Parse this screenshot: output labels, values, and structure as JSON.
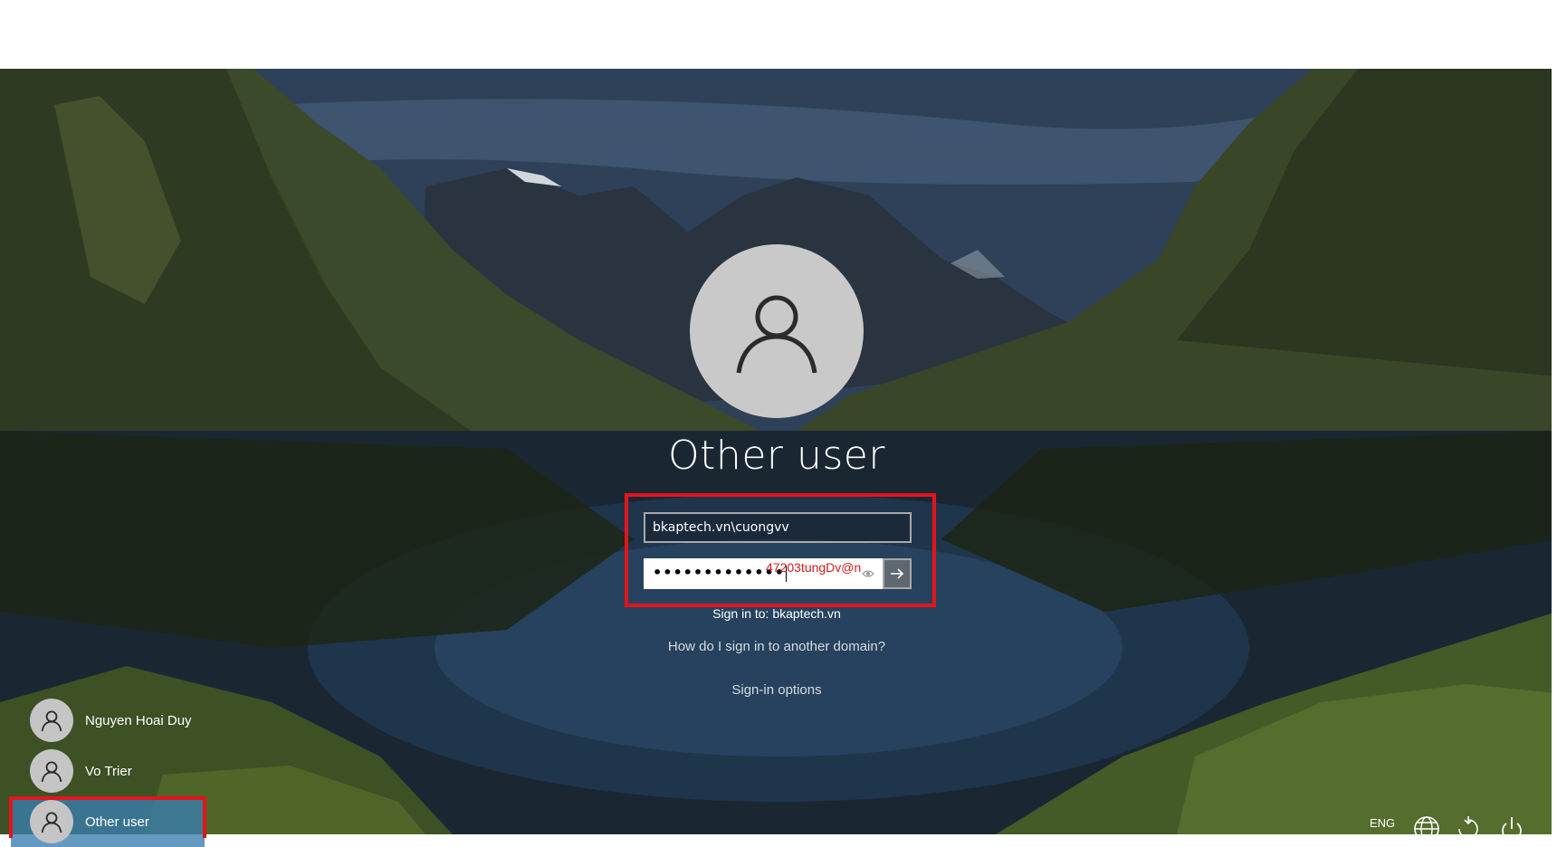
{
  "user_tile": {
    "name": "Other user",
    "avatar_icon": "user-silhouette-icon"
  },
  "credentials": {
    "username_value": "bkaptech.vn\\cuongvv",
    "password_mask": "•••••••••••••",
    "password_annotation": "47203tungDv@n",
    "submit_icon": "arrow-right-icon",
    "reveal_icon": "eye-icon"
  },
  "sign_in_to": "Sign in to: bkaptech.vn",
  "links": {
    "another_domain": "How do I sign in to another domain?",
    "sign_in_options": "Sign-in options"
  },
  "user_list": [
    {
      "name": "Nguyen Hoai Duy",
      "selected": false
    },
    {
      "name": "Vo Trier",
      "selected": false
    },
    {
      "name": "Other user",
      "selected": true
    }
  ],
  "tray": {
    "language": "ENG",
    "network_icon": "globe-icon",
    "accessibility_icon": "ease-of-access-icon",
    "power_icon": "power-icon"
  },
  "colors": {
    "highlight": "#e3141b",
    "selected_user": "#387daf"
  }
}
